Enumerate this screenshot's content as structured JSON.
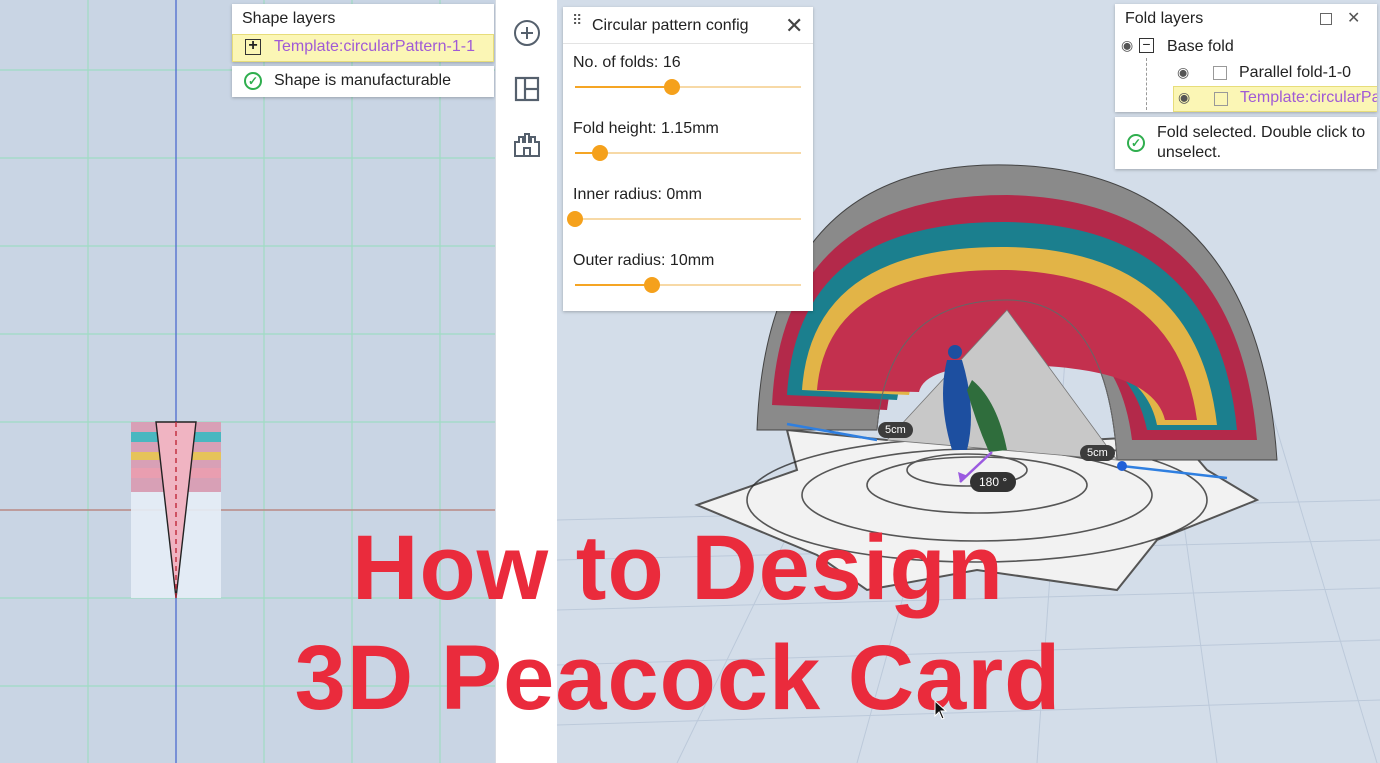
{
  "shape_layers": {
    "title": "Shape layers",
    "item_label": "Template:circularPattern-1-1",
    "status": "Shape is manufacturable"
  },
  "pattern_config": {
    "title": "Circular pattern config",
    "sliders": [
      {
        "label": "No. of folds: 16",
        "fraction": 0.43
      },
      {
        "label": "Fold height: 1.15mm",
        "fraction": 0.11
      },
      {
        "label": "Inner radius: 0mm",
        "fraction": 0.0
      },
      {
        "label": "Outer radius: 10mm",
        "fraction": 0.34
      }
    ]
  },
  "fold_layers": {
    "title": "Fold layers",
    "root": "Base fold",
    "children": [
      "Parallel fold-1-0",
      "Template:circularPa"
    ],
    "status": "Fold selected. Double click to unselect."
  },
  "viewport_labels": {
    "dim_left": "5cm",
    "dim_right": "5cm",
    "angle": "180 °"
  },
  "overlay": {
    "line1": "How to Design",
    "line2": "3D Peacock Card"
  },
  "colors": {
    "accent_orange": "#f5a11c",
    "highlight_purple": "#a05ad6",
    "title_red": "#ea2b3c"
  }
}
